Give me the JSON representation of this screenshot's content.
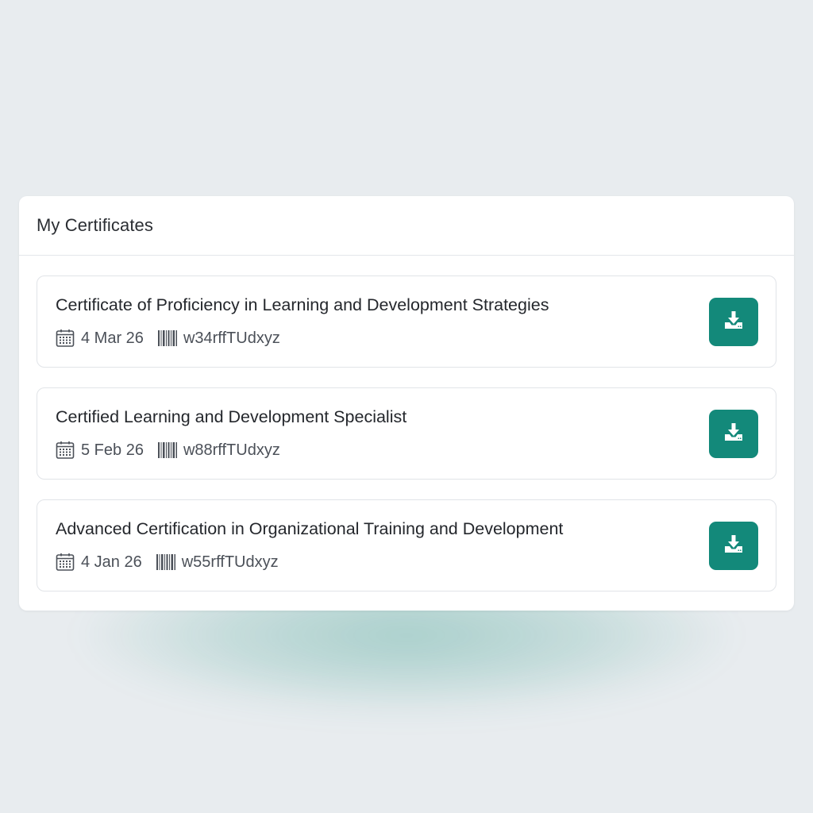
{
  "panel": {
    "title": "My Certificates"
  },
  "certificates": [
    {
      "title": "Certificate of Proficiency in Learning and Development Strategies",
      "date": "4 Mar 26",
      "code": "w34rffTUdxyz"
    },
    {
      "title": "Certified Learning and Development Specialist",
      "date": "5 Feb 26",
      "code": "w88rffTUdxyz"
    },
    {
      "title": "Advanced Certification in Organizational Training and Development",
      "date": "4 Jan 26",
      "code": "w55rffTUdxyz"
    }
  ],
  "icons": {
    "date": "calendar-icon",
    "code": "barcode-icon",
    "action": "download-icon"
  },
  "colors": {
    "accent": "#13897a",
    "background": "#e8ecef"
  }
}
